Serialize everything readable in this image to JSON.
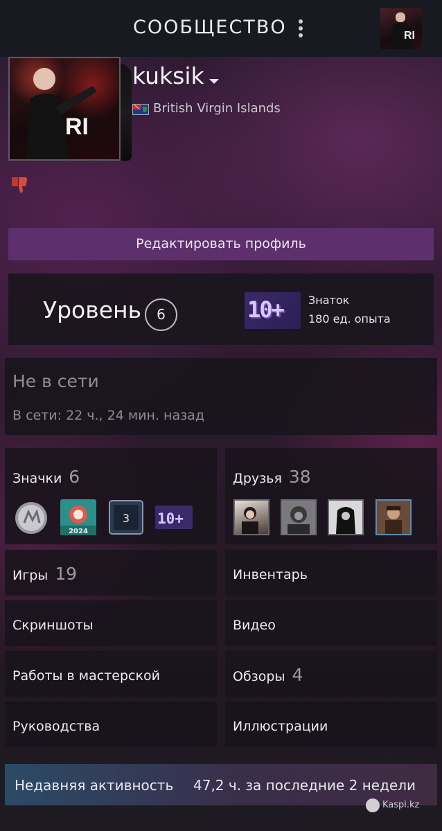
{
  "topbar": {
    "title": "СООБЩЕСТВО",
    "menu_icon": "kebab-menu-icon",
    "avatar_icon": "user-avatar"
  },
  "profile": {
    "username": "kuksik",
    "country": "British Virgin Islands",
    "flag_icon": "british-virgin-islands-flag-icon",
    "edit_button": "Редактировать профиль"
  },
  "level": {
    "label": "Уровень",
    "value": "6",
    "badge_text": "10+",
    "badge_title": "Знаток",
    "xp": "180 ед. опыта"
  },
  "status": {
    "title": "Не в сети",
    "last_online": "В сети: 22 ч., 24 мин. назад"
  },
  "badges": {
    "label": "Значки",
    "count": "6",
    "items": [
      {
        "name": "coin-badge",
        "text": ""
      },
      {
        "name": "steam-2024-badge",
        "text": "2024"
      },
      {
        "name": "years-of-service-badge",
        "text": "3"
      },
      {
        "name": "level-10-badge",
        "text": "10+"
      }
    ]
  },
  "friends": {
    "label": "Друзья",
    "count": "38"
  },
  "links": {
    "games": {
      "label": "Игры",
      "count": "19"
    },
    "inventory": {
      "label": "Инвентарь"
    },
    "screenshots": {
      "label": "Скриншоты"
    },
    "videos": {
      "label": "Видео"
    },
    "workshop": {
      "label": "Работы в мастерской"
    },
    "reviews": {
      "label": "Обзоры",
      "count": "4"
    },
    "guides": {
      "label": "Руководства"
    },
    "artwork": {
      "label": "Иллюстрации"
    }
  },
  "recent": {
    "label": "Недавняя активность",
    "value": "47,2 ч. за последние 2 недели"
  },
  "watermark": {
    "text": "Kaspi.kz"
  },
  "colors": {
    "accent_purple": "#5d2f6c",
    "topbar": "#171a21",
    "online_border": "#5a8fb3",
    "panel": "#18161c"
  }
}
